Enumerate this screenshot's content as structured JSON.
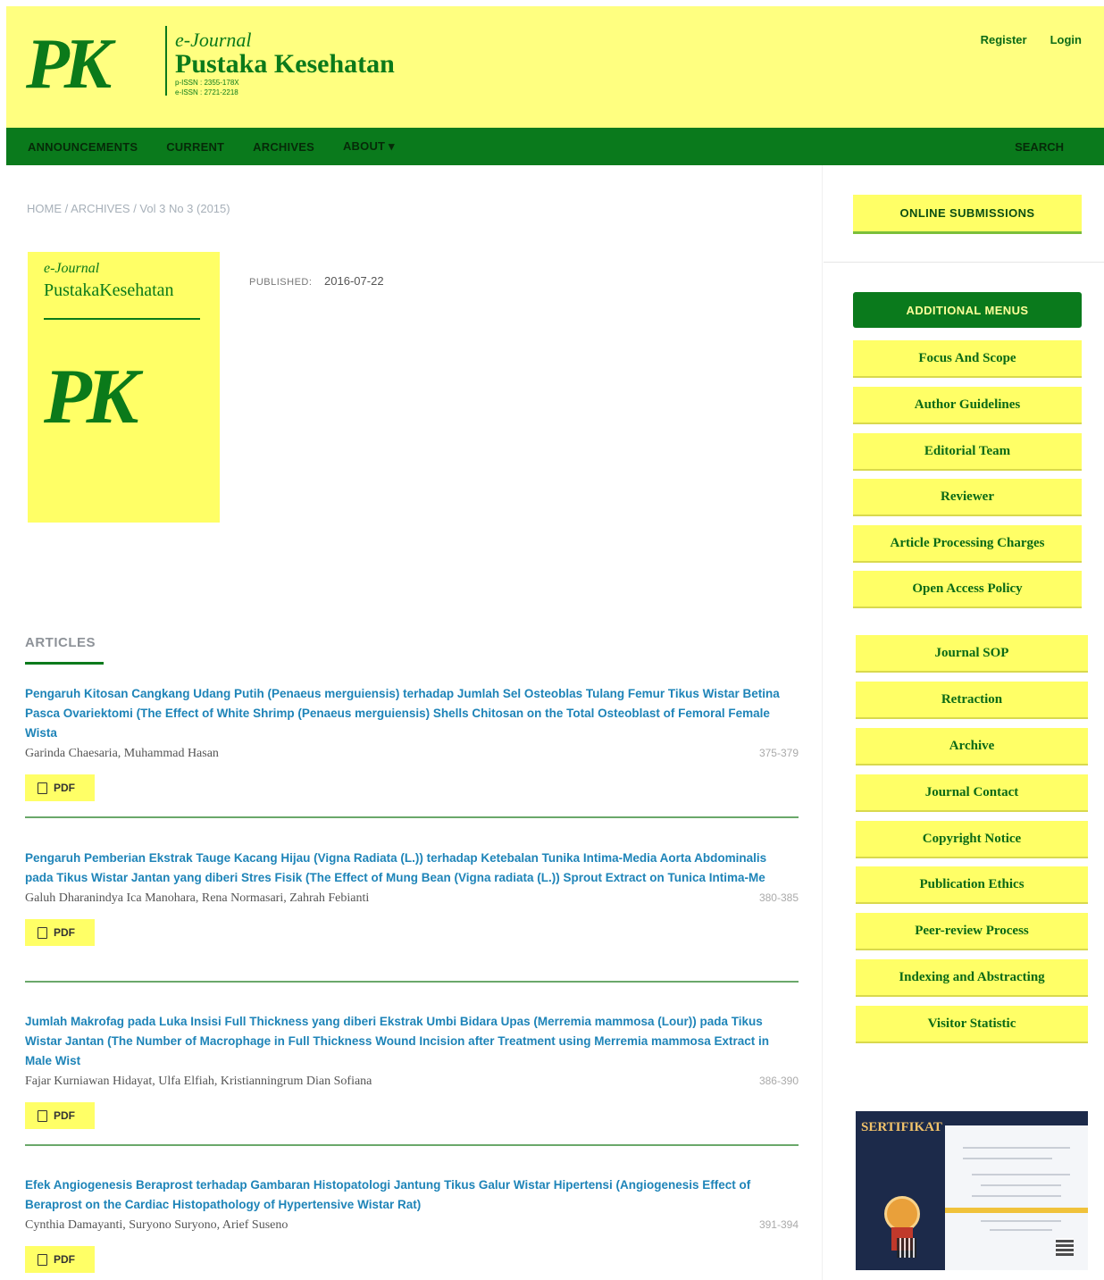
{
  "header": {
    "logo_mark": "PK",
    "ejournal": "e-Journal",
    "title": "Pustaka Kesehatan",
    "issn_print": "p-ISSN : 2355-178X",
    "issn_online": "e-ISSN : 2721-2218",
    "user_links": [
      "Register",
      "Login"
    ]
  },
  "nav": {
    "items": [
      "ANNOUNCEMENTS",
      "CURRENT",
      "ARCHIVES",
      "ABOUT ▾"
    ],
    "search": "SEARCH"
  },
  "breadcrumb": "HOME / ARCHIVES / Vol 3 No 3 (2015)",
  "cover": {
    "ejournal": "e-Journal",
    "title": "PustakaKesehatan",
    "mark": "PK"
  },
  "published": {
    "label": "PUBLISHED:",
    "date": "2016-07-22"
  },
  "articles": {
    "heading": "ARTICLES",
    "pdf_label": "PDF",
    "items": [
      {
        "title": "Pengaruh Kitosan Cangkang Udang Putih (Penaeus merguiensis) terhadap Jumlah Sel Osteoblas Tulang Femur Tikus Wistar Betina Pasca Ovariektomi (The Effect of White Shrimp (Penaeus merguiensis) Shells Chitosan on the Total Osteoblast of Femoral Female Wista",
        "authors": "Garinda Chaesaria, Muhammad Hasan",
        "pages": "375-379"
      },
      {
        "title": "Pengaruh Pemberian Ekstrak Tauge Kacang Hijau (Vigna Radiata (L.)) terhadap Ketebalan Tunika Intima-Media Aorta Abdominalis pada Tikus Wistar Jantan yang diberi Stres Fisik (The Effect of Mung Bean (Vigna radiata (L.)) Sprout Extract on Tunica Intima-Me",
        "authors": "Galuh Dharanindya Ica Manohara, Rena Normasari, Zahrah Febianti",
        "pages": "380-385"
      },
      {
        "title": "Jumlah Makrofag pada Luka Insisi Full Thickness yang diberi Ekstrak Umbi Bidara Upas (Merremia mammosa (Lour)) pada Tikus Wistar Jantan (The Number of Macrophage in Full Thickness Wound Incision after Treatment using Merremia mammosa Extract in Male Wist",
        "authors": "Fajar Kurniawan Hidayat, Ulfa Elfiah, Kristianningrum Dian Sofiana",
        "pages": "386-390"
      },
      {
        "title": "Efek Angiogenesis Beraprost terhadap Gambaran Histopatologi Jantung Tikus Galur Wistar Hipertensi (Angiogenesis Effect of Beraprost on the Cardiac Histopathology of Hypertensive Wistar Rat)",
        "authors": "Cynthia Damayanti, Suryono Suryono, Arief Suseno",
        "pages": "391-394"
      }
    ]
  },
  "sidebar": {
    "online_submissions": "ONLINE SUBMISSIONS",
    "additional_menus": "ADDITIONAL MENUS",
    "menu_a": [
      "Focus And Scope",
      "Author Guidelines",
      "Editorial Team",
      "Reviewer",
      "Article Processing Charges",
      "Open Access Policy"
    ],
    "menu_b": [
      "Journal SOP",
      "Retraction",
      "Archive",
      "Journal Contact",
      "Copyright Notice",
      "Publication Ethics",
      "Peer-review Process",
      "Indexing and Abstracting",
      "Visitor Statistic"
    ],
    "certificate_title": "SERTIFIKAT"
  },
  "colors": {
    "header_bg": "#ffff80",
    "nav_bg": "#0a7a1c",
    "brand_green": "#0b7a1a",
    "link_blue": "#1e84b8",
    "button_yellow": "#ffff66"
  }
}
